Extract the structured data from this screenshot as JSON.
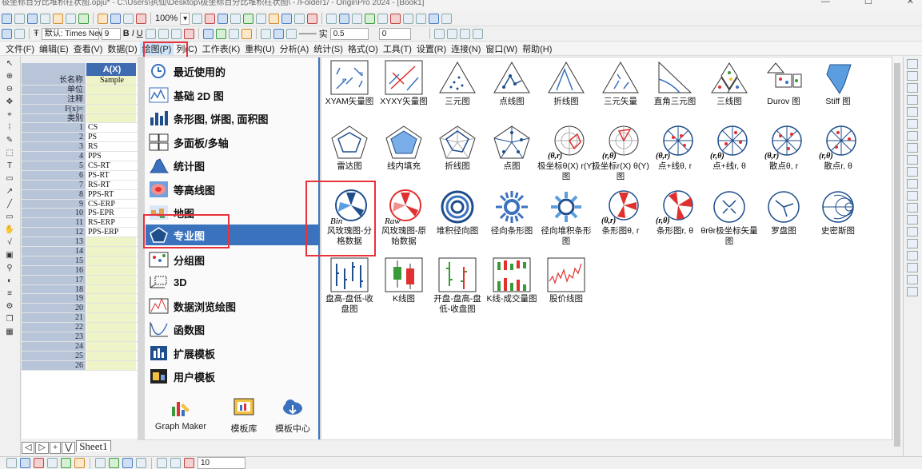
{
  "window": {
    "title": "极坐标百分比堆积柱状图.opju* - C:\\Users\\执仙\\Desktop\\极坐标百分比堆积柱状图\\ - /Folder1/ - OriginPro 2024 - [Book1]",
    "controls": [
      "—",
      "☐",
      "✕"
    ]
  },
  "toolbar1": {
    "zoom": "100%"
  },
  "toolbar2": {
    "font": "默认: Times New R",
    "size": "9",
    "line_width": "0.5",
    "value0": "0",
    "line_label": "实"
  },
  "menubar": [
    "文件(F)",
    "编辑(E)",
    "查看(V)",
    "数据(D)",
    "绘图(P)",
    "列(C)",
    "工作表(K)",
    "重构(U)",
    "分析(A)",
    "统计(S)",
    "格式(O)",
    "工具(T)",
    "设置(R)",
    "连接(N)",
    "窗口(W)",
    "帮助(H)"
  ],
  "sheet": {
    "col_header": "A(X)",
    "labels": [
      {
        "name": "长名称",
        "value": "Sample"
      },
      {
        "name": "单位",
        "value": ""
      },
      {
        "name": "注释",
        "value": ""
      },
      {
        "name": "F(x)=",
        "value": ""
      },
      {
        "name": "类别",
        "value": ""
      }
    ],
    "rows": [
      {
        "n": "1",
        "v": "CS"
      },
      {
        "n": "2",
        "v": "PS"
      },
      {
        "n": "3",
        "v": "RS"
      },
      {
        "n": "4",
        "v": "PPS"
      },
      {
        "n": "5",
        "v": "CS-RT"
      },
      {
        "n": "6",
        "v": "PS-RT"
      },
      {
        "n": "7",
        "v": "RS-RT"
      },
      {
        "n": "8",
        "v": "PPS-RT"
      },
      {
        "n": "9",
        "v": "CS-ERP"
      },
      {
        "n": "10",
        "v": "PS-EPR"
      },
      {
        "n": "11",
        "v": "RS-ERP"
      },
      {
        "n": "12",
        "v": "PPS-ERP"
      },
      {
        "n": "13",
        "v": ""
      },
      {
        "n": "14",
        "v": ""
      },
      {
        "n": "15",
        "v": ""
      },
      {
        "n": "16",
        "v": ""
      },
      {
        "n": "17",
        "v": ""
      },
      {
        "n": "18",
        "v": ""
      },
      {
        "n": "19",
        "v": ""
      },
      {
        "n": "20",
        "v": ""
      },
      {
        "n": "21",
        "v": ""
      },
      {
        "n": "22",
        "v": ""
      },
      {
        "n": "23",
        "v": ""
      },
      {
        "n": "24",
        "v": ""
      },
      {
        "n": "25",
        "v": ""
      },
      {
        "n": "26",
        "v": ""
      }
    ],
    "tab": "Sheet1"
  },
  "plot_menu": {
    "items": [
      "最近使用的",
      "基础 2D 图",
      "条形图, 饼图, 面积图",
      "多面板/多轴",
      "统计图",
      "等高线图",
      "地图",
      "专业图",
      "分组图",
      "3D",
      "数据浏览绘图",
      "函数图",
      "扩展模板",
      "用户模板"
    ],
    "selected": "专业图",
    "bottom": [
      "Graph Maker",
      "模板库",
      "模板中心"
    ]
  },
  "gallery": {
    "row1": [
      "XYAM矢量图",
      "XYXY矢量图",
      "三元图",
      "点线图",
      "折线图",
      "三元矢量",
      "直角三元图",
      "三线图",
      "Durov 图",
      "Stiff 图"
    ],
    "row2": [
      "雷达图",
      "线内填充",
      "折线图",
      "点图",
      "极坐标θ(X) r(Y)图",
      "极坐标r(X) θ(Y)图",
      "点+线θ, r",
      "点+线r, θ",
      "散点θ, r",
      "散点r, θ"
    ],
    "row3": [
      "风玫瑰图-分格数据",
      "风玫瑰图-原始数据",
      "堆积径向图",
      "径向条形图",
      "径向堆积条形图",
      "条形图θ, r",
      "条形图r, θ",
      "θrθr极坐标矢量图",
      "罗盘图",
      "史密斯图"
    ],
    "row4": [
      "盘高-盘低-收盘图",
      "K线图",
      "开盘-盘高-盘低-收盘图",
      "K线-成交量图",
      "股价线图"
    ],
    "icon_text": {
      "bin": "Bin",
      "raw": "Raw",
      "theta_r": "(θ,r)",
      "r_theta": "(r,θ)"
    }
  },
  "status": {
    "value": "10"
  },
  "colors": {
    "accent": "#3a72be",
    "highlight": "#e8323c",
    "sheet_header": "#b8c5d8"
  }
}
